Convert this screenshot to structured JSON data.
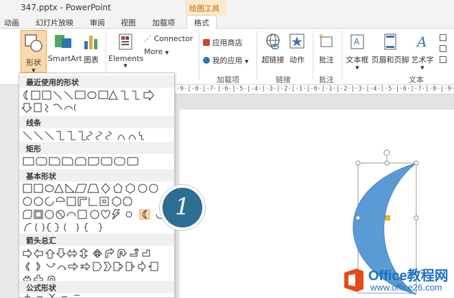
{
  "window": {
    "title": "347.pptx - PowerPoint",
    "context_tab": "绘图工具"
  },
  "tabs": [
    "动画",
    "幻灯片放映",
    "审阅",
    "视图",
    "加载项",
    "格式"
  ],
  "ribbon": {
    "shapes_label": "形状",
    "smartart_label": "SmartArt",
    "chart_label": "图表",
    "elements_label": "Elements",
    "connector_label": "Connector",
    "more_label": "More",
    "store_label": "应用商店",
    "myapps_label": "我的应用",
    "addins_group": "加载项",
    "hyperlink_label": "超链接",
    "action_label": "动作",
    "links_group": "链接",
    "comment_label": "批注",
    "comments_group": "批注",
    "textbox_label": "文本框",
    "headerfooter_label": "页眉和页脚",
    "wordart_label": "艺术字",
    "text_group": "文本"
  },
  "ruler": {
    "text": "·9·|·8·|·7·|·6·|·5·|·4·|·3·|·2·|·1·|·0·|·1·|·2·|·3·|·4·|·5·|·6·|·7·|·8·|·9·|"
  },
  "dropdown": {
    "categories": [
      "最近使用的形状",
      "线条",
      "矩形",
      "基本形状",
      "箭头总汇",
      "公式形状"
    ]
  },
  "callout": {
    "number": "1"
  },
  "colors": {
    "moon_fill": "#5b9bd5",
    "callout": "#2c6f93",
    "accent": "#c5650f"
  },
  "watermark": {
    "brand": "Office教程网",
    "url": "www.office26.com"
  }
}
